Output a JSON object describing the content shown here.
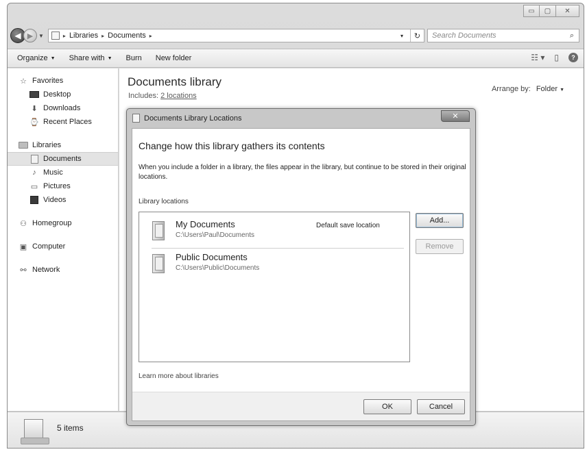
{
  "window": {
    "caption_buttons": {
      "minimize": "▭",
      "maximize": "▢",
      "close": "✕"
    }
  },
  "nav": {
    "back_glyph": "◀",
    "forward_glyph": "▶",
    "history_glyph": "▼",
    "breadcrumb": [
      "Libraries",
      "Documents"
    ],
    "crumb_separator": "▸",
    "address_dropdown_glyph": "▾",
    "refresh_glyph": "↻",
    "search_placeholder": "Search Documents",
    "search_icon_glyph": "⌕"
  },
  "toolbar": {
    "organize": "Organize",
    "share_with": "Share with",
    "burn": "Burn",
    "new_folder": "New folder",
    "dropdown_glyph": "▼",
    "views_glyph": "☷ ▾",
    "preview_pane_glyph": "▯",
    "help_glyph": "?"
  },
  "sidebar": {
    "favorites": "Favorites",
    "favorites_items": [
      "Desktop",
      "Downloads",
      "Recent Places"
    ],
    "libraries": "Libraries",
    "libraries_items": [
      "Documents",
      "Music",
      "Pictures",
      "Videos"
    ],
    "homegroup": "Homegroup",
    "computer": "Computer",
    "network": "Network",
    "selected": "Documents",
    "glyphs": {
      "favorites": "☆",
      "downloads": "⬇",
      "recent_places": "⌚",
      "music": "♪",
      "pictures": "▭",
      "homegroup": "⚇",
      "computer": "▣",
      "network": "⚯"
    }
  },
  "content": {
    "title": "Documents library",
    "includes_label": "Includes:",
    "includes_link": "2 locations",
    "arrange_label": "Arrange by:",
    "arrange_value": "Folder",
    "arrange_glyph": "▼"
  },
  "status": {
    "items_text": "5 items"
  },
  "dialog": {
    "title": "Documents Library Locations",
    "close_glyph": "✕",
    "heading": "Change how this library gathers its contents",
    "description": "When you include a folder in a library, the files appear in the library, but continue to be stored in their original locations.",
    "locations_label": "Library locations",
    "locations": [
      {
        "name": "My Documents",
        "path": "C:\\Users\\Paul\\Documents",
        "note": "Default save location"
      },
      {
        "name": "Public Documents",
        "path": "C:\\Users\\Public\\Documents",
        "note": ""
      }
    ],
    "add_button": "Add...",
    "remove_button": "Remove",
    "learn_more": "Learn more about libraries",
    "ok_button": "OK",
    "cancel_button": "Cancel"
  }
}
